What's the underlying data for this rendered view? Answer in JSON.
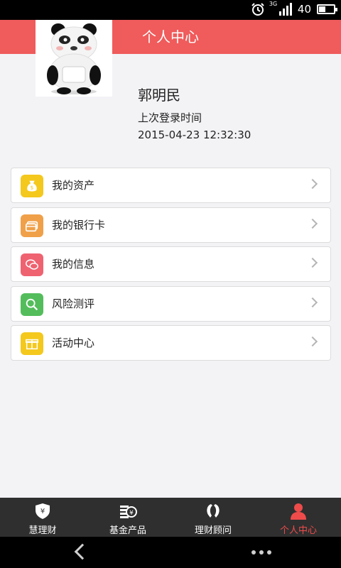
{
  "status_bar": {
    "network_tag": "3G",
    "battery_text": "40",
    "battery_level": 0.4,
    "icons": [
      "alarm-icon",
      "signal-icon",
      "battery-icon"
    ]
  },
  "header": {
    "title": "个人中心"
  },
  "profile": {
    "name": "郭明民",
    "last_login_label": "上次登录时间",
    "last_login_time": "2015-04-23 12:32:30"
  },
  "menu": {
    "items": [
      {
        "label": "我的资产",
        "icon": "money-bag-icon",
        "color": "#f4c81d"
      },
      {
        "label": "我的银行卡",
        "icon": "bank-card-icon",
        "color": "#f0a048"
      },
      {
        "label": "我的信息",
        "icon": "message-icon",
        "color": "#ef6270"
      },
      {
        "label": "风险测评",
        "icon": "search-icon",
        "color": "#53bd5b"
      },
      {
        "label": "活动中心",
        "icon": "gift-icon",
        "color": "#f4c81d"
      }
    ]
  },
  "tabbar": {
    "tabs": [
      {
        "label": "慧理财",
        "icon": "shield-yen-icon",
        "active": false
      },
      {
        "label": "基金产品",
        "icon": "coins-icon",
        "active": false
      },
      {
        "label": "理财顾问",
        "icon": "advisor-icon",
        "active": false
      },
      {
        "label": "个人中心",
        "icon": "person-icon",
        "active": true
      }
    ]
  },
  "colors": {
    "accent": "#f05b5b",
    "active_tab": "#ef4b4b",
    "tabbar_bg": "#2f2f2f"
  }
}
